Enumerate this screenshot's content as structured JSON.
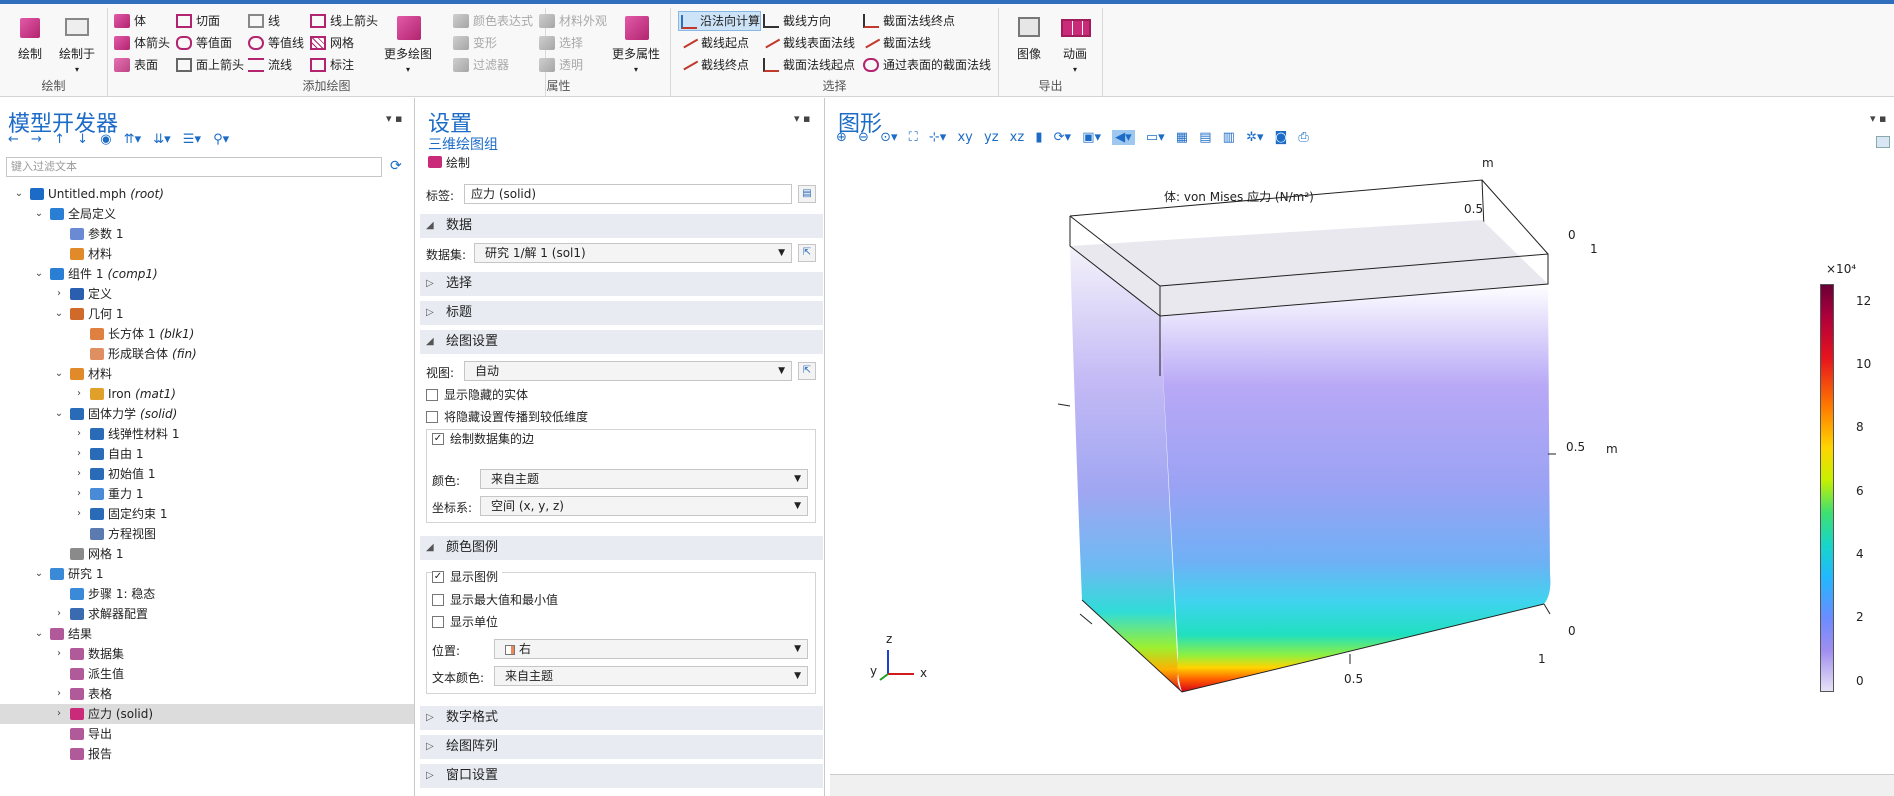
{
  "ribbon": {
    "groups": {
      "plot": "绘制",
      "add_plot": "添加绘图",
      "attributes": "属性",
      "selection": "选择",
      "export": "导出"
    },
    "plot_btn": "绘制",
    "plot_in_btn": "绘制于",
    "volume": "体",
    "volume_arrow": "体箭头",
    "surface": "表面",
    "slice": "切面",
    "isosurface": "等值面",
    "surface_arrow": "面上箭头",
    "line": "线",
    "contour": "等值线",
    "streamline": "流线",
    "line_arrow": "线上箭头",
    "mesh": "网格",
    "annotation": "标注",
    "more_plots": "更多绘图",
    "color_expression": "颜色表达式",
    "material_appearance": "材料外观",
    "deformation": "变形",
    "selection_attr": "选择",
    "filter": "过滤器",
    "transparency": "透明",
    "more_attributes": "更多属性",
    "normal_calc": "沿法向计算",
    "line_start": "截线起点",
    "line_end": "截线终点",
    "line_direction": "截线方向",
    "line_surface_normal": "截线表面法线",
    "plane_normal_start": "截面法线起点",
    "plane_normal_end": "截面法线终点",
    "plane_normal": "截面法线",
    "through_surface_plane": "通过表面的截面法线",
    "image": "图像",
    "animation": "动画"
  },
  "model": {
    "title": "模型开发器",
    "filter_placeholder": "键入过滤文本",
    "tree": [
      {
        "label": "Untitled.mph",
        "tag": "(root)"
      },
      {
        "label": "全局定义",
        "tag": ""
      },
      {
        "label": "参数 1",
        "tag": ""
      },
      {
        "label": "材料",
        "tag": ""
      },
      {
        "label": "组件 1",
        "tag": "(comp1)"
      },
      {
        "label": "定义",
        "tag": ""
      },
      {
        "label": "几何 1",
        "tag": ""
      },
      {
        "label": "长方体 1",
        "tag": "(blk1)"
      },
      {
        "label": "形成联合体",
        "tag": "(fin)"
      },
      {
        "label": "材料",
        "tag": ""
      },
      {
        "label": "Iron",
        "tag": "(mat1)"
      },
      {
        "label": "固体力学",
        "tag": "(solid)"
      },
      {
        "label": "线弹性材料 1",
        "tag": ""
      },
      {
        "label": "自由 1",
        "tag": ""
      },
      {
        "label": "初始值 1",
        "tag": ""
      },
      {
        "label": "重力 1",
        "tag": ""
      },
      {
        "label": "固定约束 1",
        "tag": ""
      },
      {
        "label": "方程视图",
        "tag": ""
      },
      {
        "label": "网格 1",
        "tag": ""
      },
      {
        "label": "研究 1",
        "tag": ""
      },
      {
        "label": "步骤 1: 稳态",
        "tag": ""
      },
      {
        "label": "求解器配置",
        "tag": ""
      },
      {
        "label": "结果",
        "tag": ""
      },
      {
        "label": "数据集",
        "tag": ""
      },
      {
        "label": "派生值",
        "tag": ""
      },
      {
        "label": "表格",
        "tag": ""
      },
      {
        "label": "应力 (solid)",
        "tag": ""
      },
      {
        "label": "导出",
        "tag": ""
      },
      {
        "label": "报告",
        "tag": ""
      }
    ]
  },
  "settings": {
    "title": "设置",
    "subtitle": "三维绘图组",
    "plot_label": "绘制",
    "label_text": "标签:",
    "label_value": "应力 (solid)",
    "sections": {
      "data": "数据",
      "selection": "选择",
      "title": "标题",
      "plot_settings": "绘图设置",
      "color_legend": "颜色图例",
      "number_format": "数字格式",
      "plot_array": "绘图阵列",
      "window_settings": "窗口设置"
    },
    "dataset_label": "数据集:",
    "dataset_value": "研究 1/解 1 (sol1)",
    "view_label": "视图:",
    "view_value": "自动",
    "show_hidden": "显示隐藏的实体",
    "propagate_hidden": "将隐藏设置传播到较低维度",
    "plot_edges": "绘制数据集的边",
    "color_label": "颜色:",
    "color_value": "来自主题",
    "coord_label": "坐标系:",
    "coord_value": "空间 (x, y, z)",
    "show_legend": "显示图例",
    "show_maxmin": "显示最大值和最小值",
    "show_units": "显示单位",
    "position_label": "位置:",
    "position_value": "右",
    "text_color_label": "文本颜色:",
    "text_color_value": "来自主题"
  },
  "graphics": {
    "title": "图形",
    "plot_title": "体: von Mises 应力 (N/m²)",
    "axis_unit": "m",
    "ticks": {
      "y_top": "0.5",
      "y_zero": "0",
      "x_one_top": "1",
      "z_half": "0.5",
      "z_zero": "0",
      "x_one_bottom": "1",
      "x_half": "0.5"
    },
    "triad": {
      "x": "x",
      "y": "y",
      "z": "z"
    },
    "colorbar": {
      "exponent": "×10⁴",
      "ticks": [
        "12",
        "10",
        "8",
        "6",
        "4",
        "2",
        "0"
      ],
      "min": 0,
      "max": 135000
    }
  },
  "colors": {
    "accent": "#1c6cc7",
    "section_bg": "#e8ecf2",
    "selected_row": "#dcdcdc"
  }
}
